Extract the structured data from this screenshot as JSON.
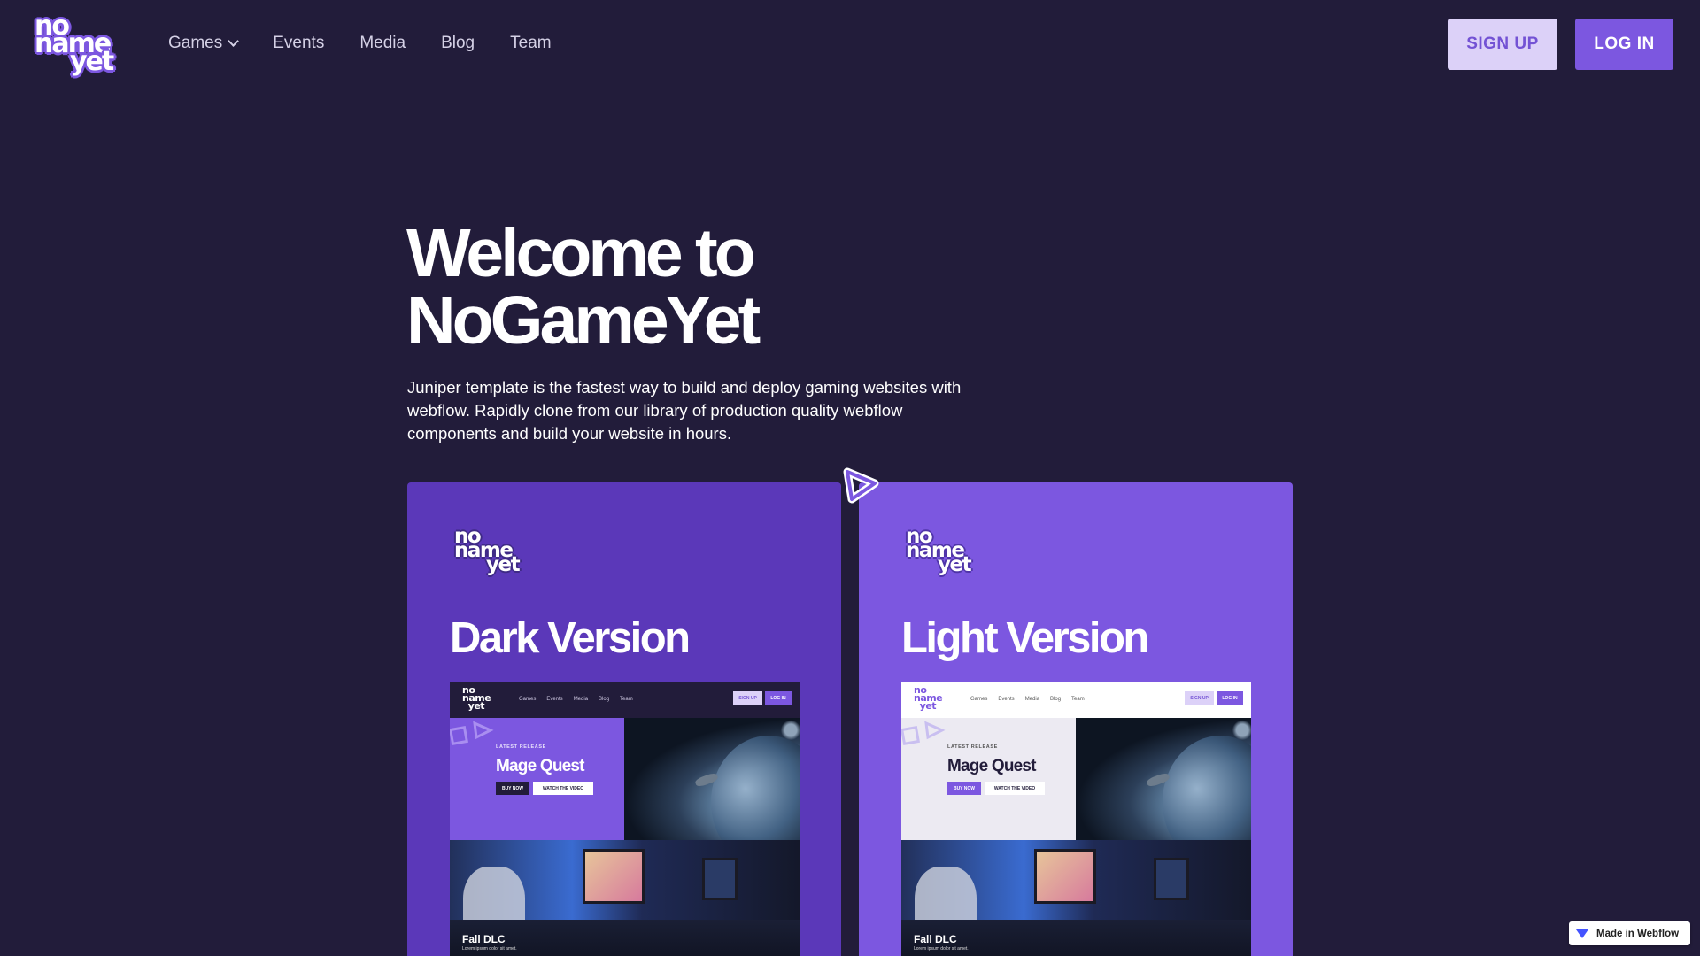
{
  "nav": {
    "logo": {
      "line1": "no",
      "line2": "name",
      "line3": "yet"
    },
    "links": [
      {
        "label": "Games",
        "has_dropdown": true
      },
      {
        "label": "Events"
      },
      {
        "label": "Media"
      },
      {
        "label": "Blog"
      },
      {
        "label": "Team"
      }
    ],
    "signup_label": "SIGN UP",
    "login_label": "LOG IN"
  },
  "hero": {
    "title_line1": "Welcome to",
    "title_line2": "NoGameYet",
    "description": "Juniper template is the fastest way to build and deploy gaming websites with webflow. Rapidly clone from our library of production quality webflow components and build your website in hours."
  },
  "cards": [
    {
      "title": "Dark Version",
      "preview": {
        "nav_links": [
          "Games",
          "Events",
          "Media",
          "Blog",
          "Team"
        ],
        "signup": "SIGN UP",
        "login": "LOG IN",
        "label": "LATEST RELEASE",
        "title": "Mage Quest",
        "buy": "BUY NOW",
        "watch": "WATCH THE VIDEO",
        "dlc_title": "Fall DLC",
        "dlc_sub": "Lorem ipsum dolor sit amet."
      }
    },
    {
      "title": "Light Version",
      "preview": {
        "nav_links": [
          "Games",
          "Events",
          "Media",
          "Blog",
          "Team"
        ],
        "signup": "SIGN UP",
        "login": "LOG IN",
        "label": "LATEST RELEASE",
        "title": "Mage Quest",
        "buy": "BUY NOW",
        "watch": "WATCH THE VIDEO",
        "dlc_title": "Fall DLC",
        "dlc_sub": "Lorem ipsum dolor sit amet."
      }
    }
  ],
  "badge": {
    "label": "Made in Webflow",
    "icon": "webflow-icon"
  },
  "icons": {
    "play": "play-icon",
    "chevron": "chevron-down-icon"
  },
  "colors": {
    "background": "#221c3a",
    "accent": "#7c57e0",
    "accent_dark": "#5b38b9",
    "signup_bg": "#dcd1f8"
  }
}
